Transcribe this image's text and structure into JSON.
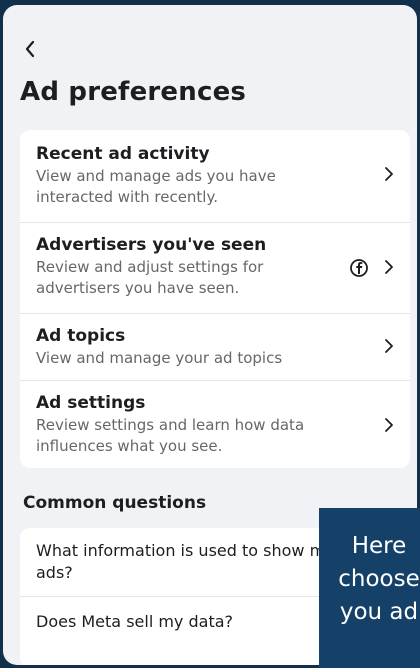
{
  "header": {
    "back_icon": "chevron-left-icon",
    "title": "Ad preferences"
  },
  "main_items": [
    {
      "title": "Recent ad activity",
      "description": "View and manage ads you have interacted with recently.",
      "icon": "chevron-right-icon"
    },
    {
      "title": "Advertisers you've seen",
      "description": "Review and adjust settings for advertisers you have seen.",
      "icon": "chevron-right-icon",
      "badge_icon": "facebook-icon"
    },
    {
      "title": "Ad topics",
      "description": "View and manage your ad topics",
      "icon": "chevron-right-icon"
    },
    {
      "title": "Ad settings",
      "description": "Review settings and learn how data influences what you see.",
      "icon": "chevron-right-icon"
    }
  ],
  "common_questions": {
    "heading": "Common questions",
    "items": [
      {
        "text": "What information is used to show me ads?"
      },
      {
        "text": "Does Meta sell my data?"
      }
    ]
  },
  "overlay_tooltip": {
    "lines": [
      "Here",
      "choose",
      "you ad"
    ]
  },
  "colors": {
    "page_background": "#f0f2f5",
    "card_background": "#ffffff",
    "primary_text": "#1c1e21",
    "secondary_text": "#65676b",
    "outer_background": "#12304a",
    "tooltip_background": "#154168"
  }
}
